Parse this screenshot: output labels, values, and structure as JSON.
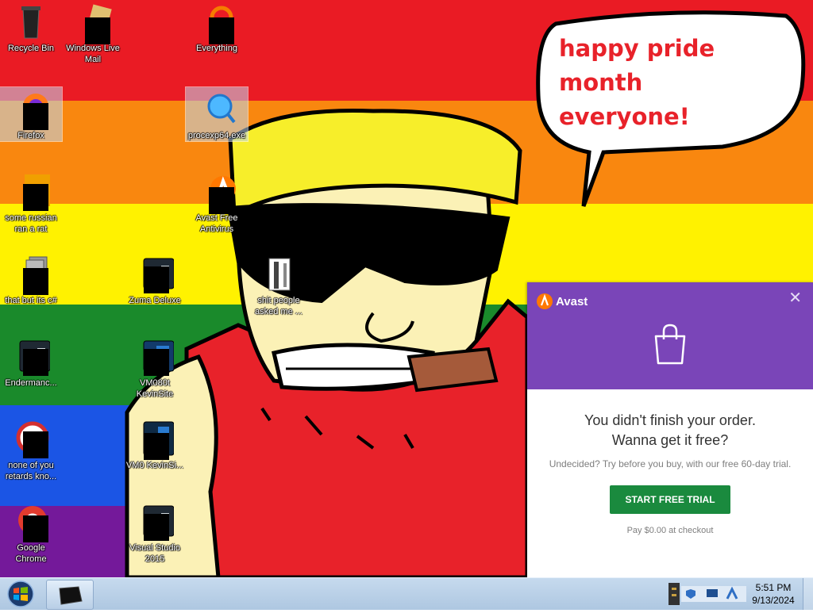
{
  "wallpaper": {
    "stripes": [
      "#ea1b24",
      "#f9870f",
      "#fff200",
      "#1a8a2b",
      "#1b55e5",
      "#74199a"
    ],
    "speech_bubble_text": "happy pride month everyone!"
  },
  "desktop_icons": [
    {
      "label": "Recycle Bin",
      "icon": "recycle-bin-icon"
    },
    {
      "label": "Windows Live Mail",
      "icon": "mail-icon"
    },
    {
      "label": "Everything",
      "icon": "search-app-icon"
    },
    {
      "label": "Firefox",
      "icon": "firefox-icon"
    },
    {
      "label": "procexp64.exe",
      "icon": "magnifier-icon"
    },
    {
      "label": "some russian ran a rat",
      "icon": "app-icon"
    },
    {
      "label": "Avast Free Antivirus",
      "icon": "avast-icon"
    },
    {
      "label": "that but its c#",
      "icon": "stack-icon"
    },
    {
      "label": "Zuma Deluxe",
      "icon": "app-icon"
    },
    {
      "label": "shit people asked me ...",
      "icon": "folder-icon"
    },
    {
      "label": "Endermanc...",
      "icon": "app-icon"
    },
    {
      "label": "VM080t KevinSite",
      "icon": "app-icon"
    },
    {
      "label": "none of you retards kno...",
      "icon": "app-icon"
    },
    {
      "label": "VM0 KevinSi...",
      "icon": "app-icon"
    },
    {
      "label": "Google Chrome",
      "icon": "chrome-icon"
    },
    {
      "label": "Visual Studio 2015",
      "icon": "app-icon"
    }
  ],
  "avast_popup": {
    "brand": "Avast",
    "close_icon": "close-icon",
    "header_icon": "shopping-bag-icon",
    "heading_line1": "You didn't finish your order.",
    "heading_line2": "Wanna get it free?",
    "subtext": "Undecided? Try before you buy, with our free 60-day trial.",
    "cta_label": "START FREE TRIAL",
    "note": "Pay $0.00 at checkout",
    "colors": {
      "header": "#7a45b8",
      "cta": "#1a8a3e",
      "brand": "#ff7800"
    }
  },
  "taskbar": {
    "start_icon": "windows-logo-icon",
    "pinned_app_icon": "app-icon",
    "tray_icons": [
      "network-icon",
      "security-shield-icon",
      "display-icon",
      "sync-icon"
    ],
    "clock_time": "5:51 PM",
    "clock_date": "9/13/2024"
  }
}
